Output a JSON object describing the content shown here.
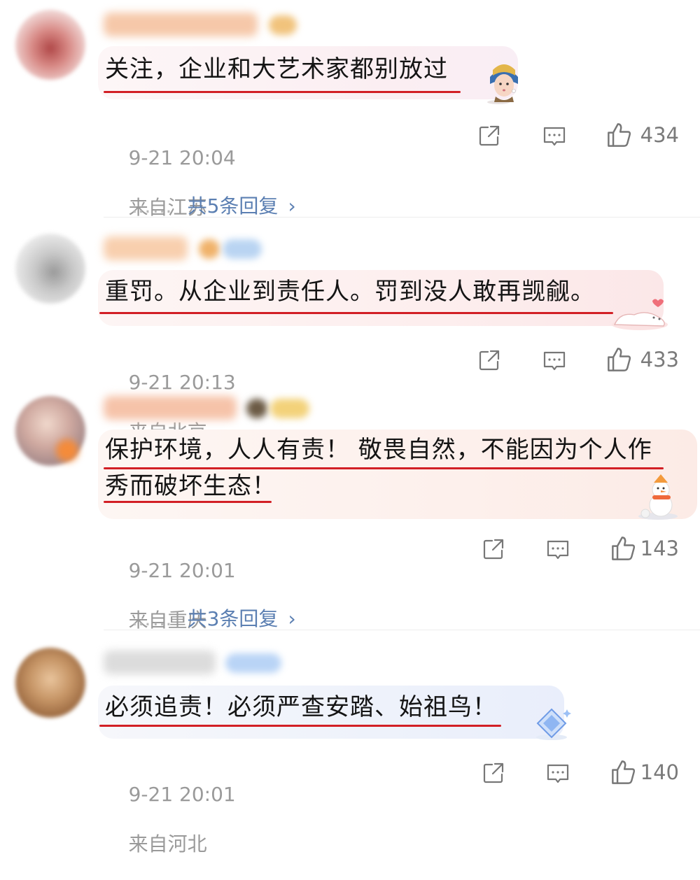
{
  "comments": [
    {
      "text_lines": [
        "关注，企业和大艺术家都别放过"
      ],
      "time": "9-21 20:04",
      "location": "来自江苏",
      "likes": "434",
      "replies": "共5条回复",
      "sticker": "girl-with-pearl-earring-sticker"
    },
    {
      "text_lines": [
        "重罚。从企业到责任人。罚到没人敢再觊觎。"
      ],
      "time": "9-21 20:13",
      "location": "来自北京",
      "likes": "433",
      "replies": null,
      "sticker": "cat-heart-sticker"
    },
    {
      "text_lines": [
        "保护环境，人人有责！ 敬畏自然，不能因为个人作",
        "秀而破坏生态！"
      ],
      "time": "9-21 20:01",
      "location": "来自重庆",
      "likes": "143",
      "replies": "共3条回复",
      "sticker": "snowman-sticker"
    },
    {
      "text_lines": [
        "必须追责！必须严查安踏、始祖鸟！"
      ],
      "time": "9-21 20:01",
      "location": "来自河北",
      "likes": "140",
      "replies": null,
      "sticker": "diamond-sticker"
    }
  ],
  "icons": {
    "share": "share-icon",
    "comment": "comment-icon",
    "like": "thumbs-up-icon",
    "chevron": "chevron-right-icon"
  },
  "colors": {
    "underline": "#d21f25",
    "reply_link": "#5b7fb2",
    "meta_text": "#9a9a9a"
  },
  "reply_dots": "……",
  "reply_chevron": "›"
}
